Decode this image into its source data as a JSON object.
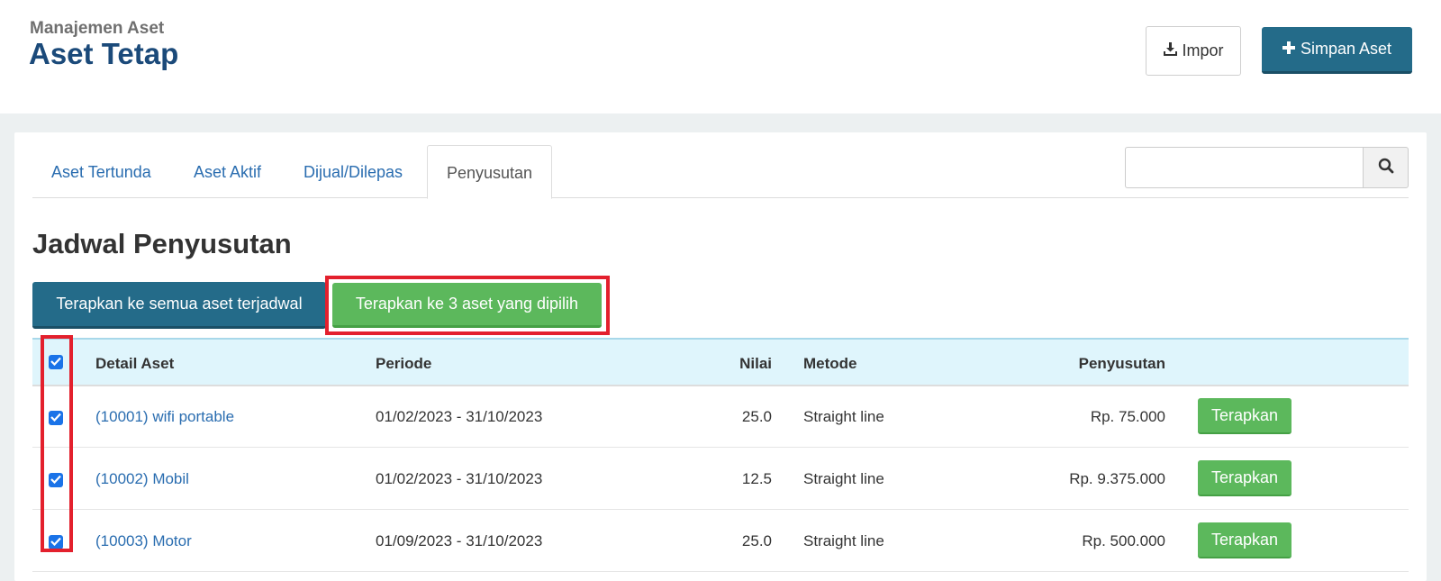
{
  "header": {
    "breadcrumb": "Manajemen Aset",
    "title": "Aset Tetap",
    "import_label": "Impor",
    "save_label": "Simpan Aset"
  },
  "tabs": [
    {
      "label": "Aset Tertunda"
    },
    {
      "label": "Aset Aktif"
    },
    {
      "label": "Dijual/Dilepas"
    },
    {
      "label": "Penyusutan",
      "active": true
    }
  ],
  "search": {
    "value": "",
    "placeholder": ""
  },
  "section": {
    "title": "Jadwal Penyusutan",
    "apply_all_label": "Terapkan ke semua aset terjadwal",
    "apply_selected_label": "Terapkan ke 3 aset yang dipilih"
  },
  "table": {
    "columns": [
      "Detail Aset",
      "Periode",
      "Nilai",
      "Metode",
      "Penyusutan"
    ],
    "select_all_checked": true,
    "rows": [
      {
        "detail": "(10001) wifi portable",
        "periode": "01/02/2023 - 31/10/2023",
        "nilai": "25.0",
        "metode": "Straight line",
        "penyusutan": "Rp. 75.000",
        "action": "Terapkan",
        "checked": true
      },
      {
        "detail": "(10002) Mobil",
        "periode": "01/02/2023 - 31/10/2023",
        "nilai": "12.5",
        "metode": "Straight line",
        "penyusutan": "Rp. 9.375.000",
        "action": "Terapkan",
        "checked": true
      },
      {
        "detail": "(10003) Motor",
        "periode": "01/09/2023 - 31/10/2023",
        "nilai": "25.0",
        "metode": "Straight line",
        "penyusutan": "Rp. 500.000",
        "action": "Terapkan",
        "checked": true
      }
    ]
  },
  "colors": {
    "primary": "#246b89",
    "success": "#5cb85c",
    "highlight": "#e3202d",
    "link": "#2a6db0",
    "title": "#1b4a7a",
    "table_header_bg": "#dff5fc"
  },
  "icons": {
    "import": "download-tray-icon",
    "save": "plus-icon",
    "search": "search-icon",
    "checkbox": "check-icon"
  }
}
